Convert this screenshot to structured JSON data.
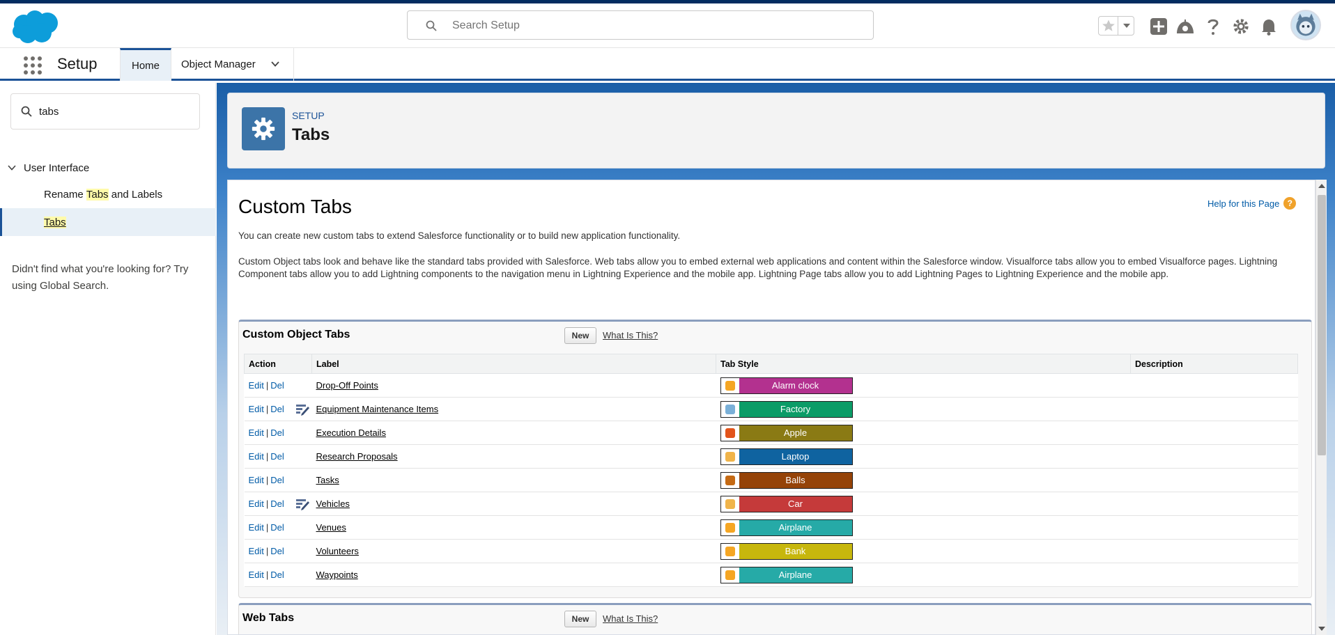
{
  "header": {
    "search_placeholder": "Search Setup",
    "icons": [
      "favorites-star-icon",
      "favorites-dropdown-icon",
      "global-actions-plus-icon",
      "trailhead-icon",
      "help-icon",
      "setup-gear-icon",
      "notifications-bell-icon",
      "user-avatar"
    ]
  },
  "context_bar": {
    "app_name": "Setup",
    "tabs": [
      {
        "label": "Home",
        "active": true
      },
      {
        "label": "Object Manager",
        "has_menu": true
      }
    ]
  },
  "sidebar": {
    "quick_find_value": "tabs",
    "section": "User Interface",
    "items": [
      {
        "pre": "Rename ",
        "highlight": "Tabs",
        "post": " and Labels",
        "active": false
      },
      {
        "pre": "",
        "highlight": "Tabs",
        "post": "",
        "active": true
      }
    ],
    "not_found_text": "Didn't find what you're looking for? Try using Global Search."
  },
  "page_header": {
    "eyebrow": "SETUP",
    "title": "Tabs"
  },
  "content": {
    "title": "Custom Tabs",
    "help_link": "Help for this Page",
    "help_badge": "?",
    "intro": "You can create new custom tabs to extend Salesforce functionality or to build new application functionality.",
    "details": "Custom Object tabs look and behave like the standard tabs provided with Salesforce. Web tabs allow you to embed external web applications and content within the Salesforce window. Visualforce tabs allow you to embed Visualforce pages. Lightning Component tabs allow you to add Lightning components to the navigation menu in Lightning Experience and the mobile app. Lightning Page tabs allow you to add Lightning Pages to Lightning Experience and the mobile app."
  },
  "custom_object_tabs": {
    "title": "Custom Object Tabs",
    "new_label": "New",
    "what_label": "What Is This?",
    "columns": [
      "Action",
      "Label",
      "Tab Style",
      "Description"
    ],
    "edit_label": "Edit",
    "sep": "|",
    "del_label": "Del",
    "rows": [
      {
        "label": "Drop-Off Points",
        "style": "Alarm clock",
        "color": "#b3318f",
        "icon_color": "#f5a623",
        "managed": false,
        "description": ""
      },
      {
        "label": "Equipment Maintenance Items",
        "style": "Factory",
        "color": "#0b9c67",
        "icon_color": "#7ab0d8",
        "managed": true,
        "description": ""
      },
      {
        "label": "Execution Details",
        "style": "Apple",
        "color": "#8a7a14",
        "icon_color": "#e2541b",
        "managed": false,
        "description": ""
      },
      {
        "label": "Research Proposals",
        "style": "Laptop",
        "color": "#0f63a0",
        "icon_color": "#f0b44a",
        "managed": false,
        "description": ""
      },
      {
        "label": "Tasks",
        "style": "Balls",
        "color": "#954308",
        "icon_color": "#c56a14",
        "managed": false,
        "description": ""
      },
      {
        "label": "Vehicles",
        "style": "Car",
        "color": "#c53a3a",
        "icon_color": "#f0b44a",
        "managed": true,
        "description": ""
      },
      {
        "label": "Venues",
        "style": "Airplane",
        "color": "#26aaa7",
        "icon_color": "#f5a623",
        "managed": false,
        "description": ""
      },
      {
        "label": "Volunteers",
        "style": "Bank",
        "color": "#c7b70d",
        "icon_color": "#f5a623",
        "managed": false,
        "description": ""
      },
      {
        "label": "Waypoints",
        "style": "Airplane",
        "color": "#26aaa7",
        "icon_color": "#f5a623",
        "managed": false,
        "description": ""
      }
    ]
  },
  "web_tabs": {
    "title": "Web Tabs",
    "new_label": "New",
    "what_label": "What Is This?"
  }
}
